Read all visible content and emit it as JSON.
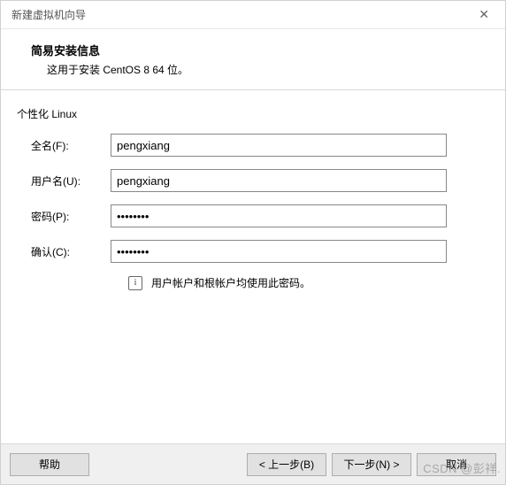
{
  "window": {
    "title": "新建虚拟机向导",
    "close": "✕"
  },
  "header": {
    "title": "简易安装信息",
    "subtitle": "这用于安装 CentOS 8 64 位。"
  },
  "section": {
    "label": "个性化 Linux"
  },
  "form": {
    "fullname": {
      "label": "全名(F):",
      "value": "pengxiang"
    },
    "username": {
      "label": "用户名(U):",
      "value": "pengxiang"
    },
    "password": {
      "label": "密码(P):",
      "value": "••••••••"
    },
    "confirm": {
      "label": "确认(C):",
      "value": "••••••••"
    }
  },
  "hint": {
    "icon": "i",
    "text": "用户帐户和根帐户均使用此密码。"
  },
  "footer": {
    "help": "帮助",
    "back": "< 上一步(B)",
    "next": "下一步(N) >",
    "cancel": "取消"
  },
  "watermark": "CSDN @彭祥."
}
